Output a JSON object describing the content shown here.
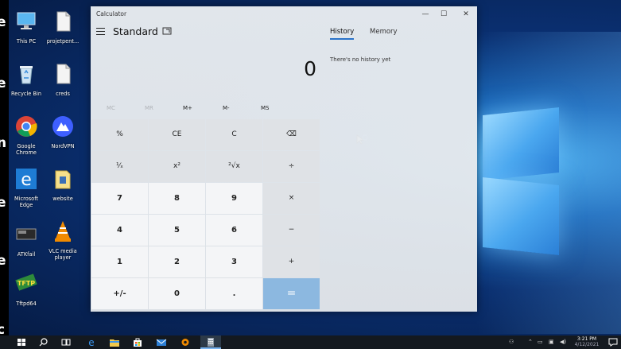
{
  "edge_letters": [
    "e",
    "e",
    "n",
    "e",
    "e",
    "c"
  ],
  "desktop_icons": [
    {
      "label": "This PC"
    },
    {
      "label": "projetpent..."
    },
    {
      "label": "Recycle Bin"
    },
    {
      "label": "creds"
    },
    {
      "label": "Google Chrome"
    },
    {
      "label": "NordVPN"
    },
    {
      "label": "Microsoft Edge"
    },
    {
      "label": "website"
    },
    {
      "label": "ATKfail"
    },
    {
      "label": "VLC media player"
    },
    {
      "label": "Tftpd64"
    }
  ],
  "calculator": {
    "window_title": "Calculator",
    "controls": {
      "minimize": "—",
      "maximize": "☐",
      "close": "✕"
    },
    "mode": "Standard",
    "display_value": "0",
    "memory_buttons": [
      "MC",
      "MR",
      "M+",
      "M-",
      "MS"
    ],
    "keys": [
      [
        "%",
        "CE",
        "C",
        "⌫"
      ],
      [
        "¹⁄ₓ",
        "x²",
        "²√x",
        "÷"
      ],
      [
        "7",
        "8",
        "9",
        "×"
      ],
      [
        "4",
        "5",
        "6",
        "−"
      ],
      [
        "1",
        "2",
        "3",
        "+"
      ],
      [
        "+/-",
        "0",
        ".",
        "="
      ]
    ],
    "history_tab": "History",
    "memory_tab": "Memory",
    "history_empty": "There's no history yet"
  },
  "taskbar": {
    "time": "3:21 PM",
    "date": "4/12/2021"
  }
}
